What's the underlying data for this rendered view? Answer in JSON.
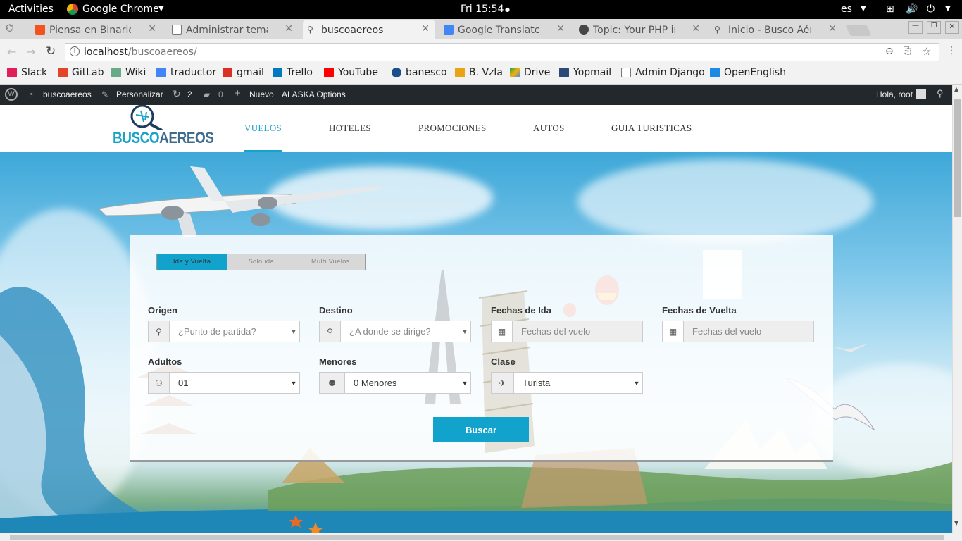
{
  "system": {
    "activities": "Activities",
    "app": "Google Chrome",
    "clock": "Fri 15:54",
    "lang": "es"
  },
  "tabs": [
    {
      "label": "Piensa en Binario: Co",
      "favicon_color": "#f4511e"
    },
    {
      "label": "Administrar temas de",
      "favicon_color": "#555555"
    },
    {
      "label": "buscoaereos",
      "favicon_color": "#555555"
    },
    {
      "label": "Google Translate",
      "favicon_color": "#4285f4"
    },
    {
      "label": "Topic: Your PHP insta",
      "favicon_color": "#464646"
    },
    {
      "label": "Inicio - Busco Aéreos",
      "favicon_color": "#555555"
    }
  ],
  "omnibox": {
    "host": "localhost",
    "path": "/buscoaereos/"
  },
  "bookmarks": [
    {
      "label": "Slack",
      "color": "#e01e5a"
    },
    {
      "label": "GitLab",
      "color": "#e24329"
    },
    {
      "label": "Wiki",
      "color": "#36c"
    },
    {
      "label": "traductor",
      "color": "#4285f4"
    },
    {
      "label": "gmail",
      "color": "#d93025"
    },
    {
      "label": "Trello",
      "color": "#0079bf"
    },
    {
      "label": "YouTube",
      "color": "#ff0000"
    },
    {
      "label": "banesco",
      "color": "#1a4f8b"
    },
    {
      "label": "B. Vzla",
      "color": "#e8a317"
    },
    {
      "label": "Drive",
      "color": "#0f9d58"
    },
    {
      "label": "Yopmail",
      "color": "#2b4a7a"
    },
    {
      "label": "Admin Django",
      "color": "#888888"
    },
    {
      "label": "OpenEnglish",
      "color": "#1e88e5"
    }
  ],
  "wpbar": {
    "site": "buscoaereos",
    "customize": "Personalizar",
    "updates": "2",
    "comments": "0",
    "new": "Nuevo",
    "options": "ALASKA Options",
    "greeting": "Hola, root"
  },
  "logo": {
    "part1": "BUSCO",
    "part2": "AEREOS"
  },
  "nav": [
    "VUELOS",
    "HOTELES",
    "PROMOCIONES",
    "AUTOS",
    "GUIA TURISTICAS"
  ],
  "search": {
    "trip_types": [
      "Ida y Vuelta",
      "Solo ida",
      "Multi Vuelos"
    ],
    "origen": {
      "label": "Origen",
      "placeholder": "¿Punto de partida?"
    },
    "destino": {
      "label": "Destino",
      "placeholder": "¿A donde se dirige?"
    },
    "ida": {
      "label": "Fechas de Ida",
      "placeholder": "Fechas del vuelo"
    },
    "vuelta": {
      "label": "Fechas de Vuelta",
      "placeholder": "Fechas del vuelo"
    },
    "adultos": {
      "label": "Adultos",
      "value": "01"
    },
    "menores": {
      "label": "Menores",
      "value": "0 Menores"
    },
    "clase": {
      "label": "Clase",
      "value": "Turista"
    },
    "submit": "Buscar"
  },
  "colors": {
    "accent": "#12a3cd",
    "wpbar": "#23282d"
  }
}
